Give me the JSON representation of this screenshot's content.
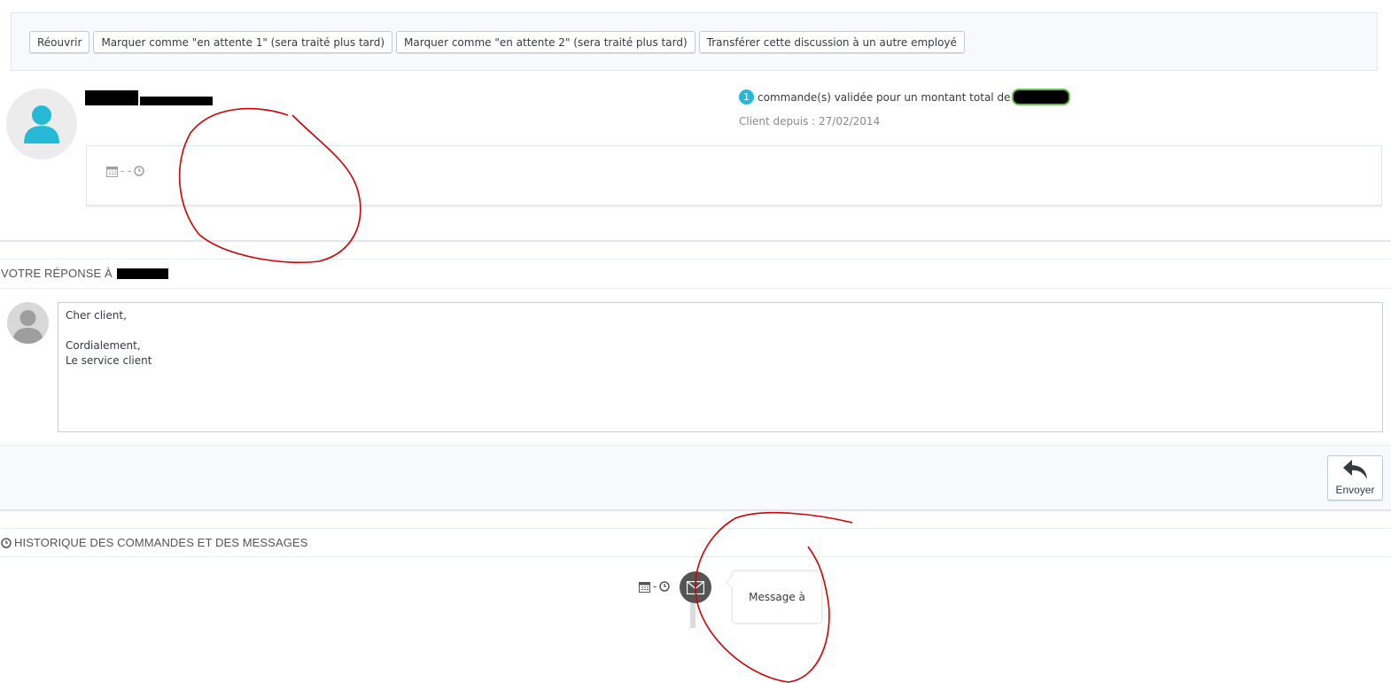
{
  "toolbar": {
    "reopen_label": "Réouvrir",
    "pending1_label": "Marquer comme \"en attente 1\" (sera traité plus tard)",
    "pending2_label": "Marquer comme \"en attente 2\" (sera traité plus tard)",
    "transfer_label": "Transférer cette discussion à un autre employé"
  },
  "customer": {
    "order_count": "1",
    "order_text": "commande(s) validée pour un montant total de",
    "client_since": "Client depuis : 27/02/2014",
    "date_separator": "- -"
  },
  "reply": {
    "heading": "Votre réponse à",
    "lines": [
      "Cher client,",
      "",
      "Cordialement,",
      "Le service client"
    ],
    "send_label": "Envoyer"
  },
  "history": {
    "heading": "Historique des commandes et des messages",
    "date_separator": "-",
    "message_label": "Message à"
  },
  "colors": {
    "accent": "#25b9d7",
    "annotation": "#d40000",
    "redaction": "#000000"
  },
  "icons": [
    "user-icon",
    "calendar-icon",
    "clock-icon",
    "reply-icon",
    "envelope-icon"
  ]
}
